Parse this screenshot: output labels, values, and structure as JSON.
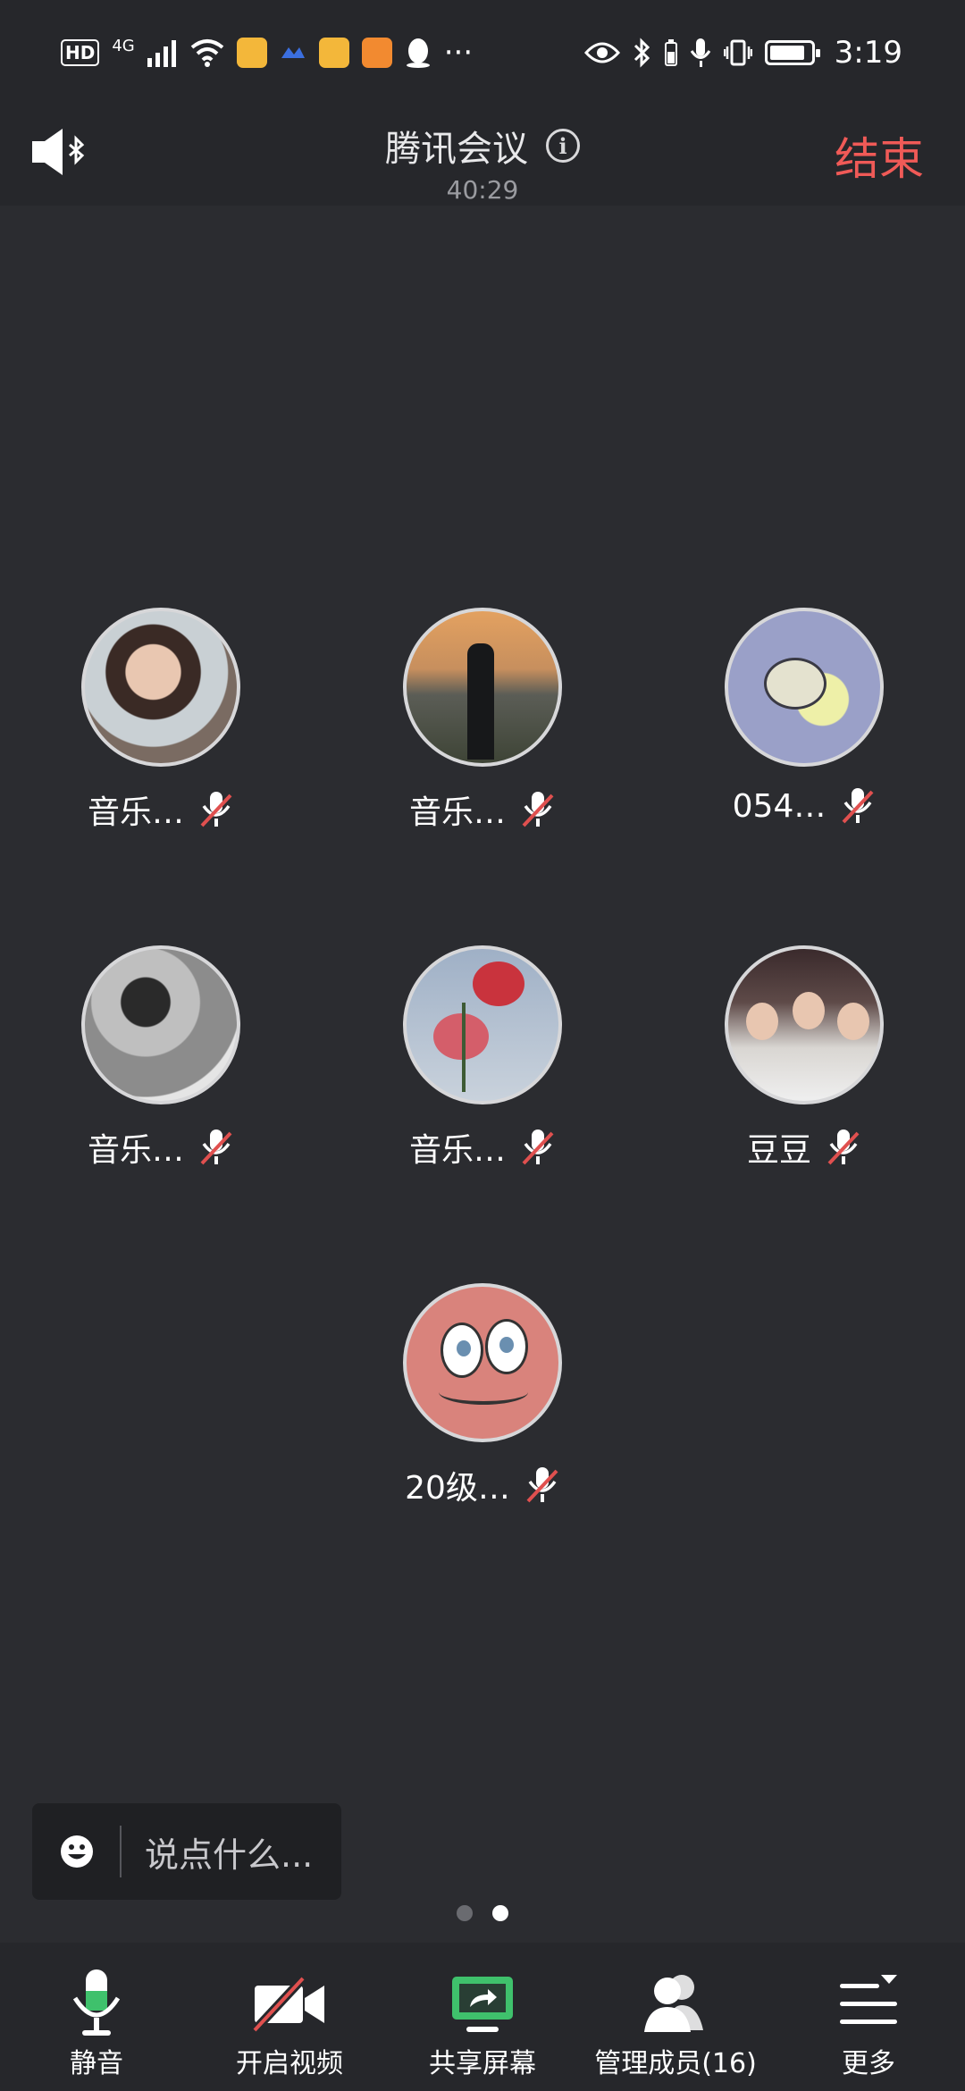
{
  "status_bar": {
    "left_badges": [
      "HD",
      "4G"
    ],
    "more": "···",
    "time": "3:19"
  },
  "header": {
    "title": "腾讯会议",
    "duration": "40:29",
    "end_label": "结束"
  },
  "participants": [
    {
      "name": "音乐…",
      "muted": true,
      "avatar": "photo-woman"
    },
    {
      "name": "音乐…",
      "muted": true,
      "avatar": "photo-sunset-man"
    },
    {
      "name": "054…",
      "muted": true,
      "avatar": "cartoon-bee"
    },
    {
      "name": "音乐…",
      "muted": true,
      "avatar": "photo-bw-man"
    },
    {
      "name": "音乐…",
      "muted": true,
      "avatar": "photo-roses"
    },
    {
      "name": "豆豆",
      "muted": true,
      "avatar": "photo-choir"
    },
    {
      "name": "20级…",
      "muted": true,
      "avatar": "cartoon-face"
    }
  ],
  "chat": {
    "placeholder": "说点什么..."
  },
  "pager": {
    "count": 2,
    "active": 2
  },
  "toolbar": {
    "mute_label": "静音",
    "video_label": "开启视频",
    "share_label": "共享屏幕",
    "members_label": "管理成员(16)",
    "more_label": "更多"
  },
  "colors": {
    "background": "#2b2c30",
    "bar": "#26272b",
    "end_red": "#f05a57",
    "mic_green": "#3fc16c",
    "muted_red": "#e0504f"
  }
}
